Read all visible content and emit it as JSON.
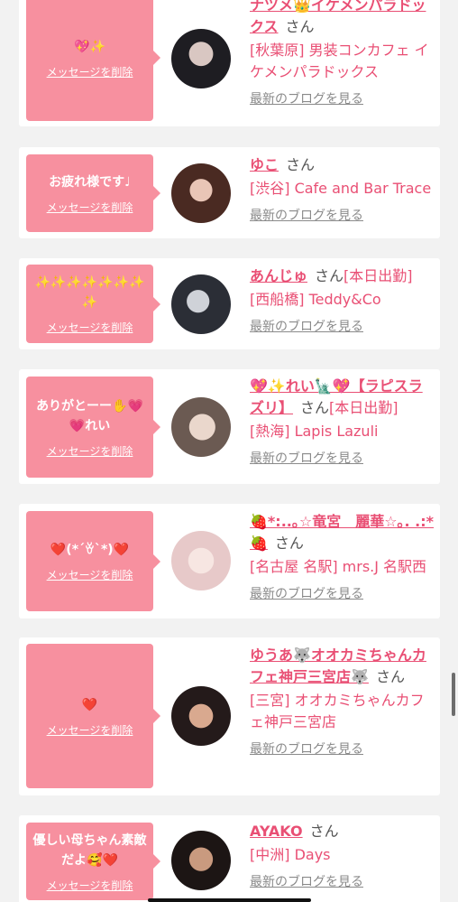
{
  "common": {
    "delete_label": "メッセージを削除",
    "san_label": "さん",
    "blog_label": "最新のブログを見る"
  },
  "cards": [
    {
      "message": "💖✨",
      "name": "ナツメ👑イケメンパラドックス",
      "today": "",
      "shop": "[秋葉原] 男装コンカフェ イケメンパラドックス",
      "avatar_colors": [
        "#1e1d22",
        "#d9c7c2"
      ]
    },
    {
      "message": "お疲れ様です♩",
      "name": "ゆこ",
      "today": "",
      "shop": "[渋谷] Cafe and Bar Trace",
      "avatar_colors": [
        "#4a2a22",
        "#e9c5b6"
      ]
    },
    {
      "message": "✨✨✨✨✨✨✨✨",
      "name": "あんじゅ",
      "today": "[本日出勤]",
      "shop": "[西船橋] Teddy&Co",
      "avatar_colors": [
        "#2b2e36",
        "#cfd2d8"
      ]
    },
    {
      "message": "ありがとーー✋💗💗れい",
      "name": "💖✨れい🗽💖【ラピスラズリ】",
      "today": "[本日出勤]",
      "shop": "[熱海] Lapis Lazuli",
      "avatar_colors": [
        "#6b5a52",
        "#ead7cc"
      ]
    },
    {
      "message": "❤️(*´ꈊ`*)❤️",
      "name": "🍓*:..｡☆竜宮　麗華☆｡. .:*🍓",
      "today": "",
      "shop": "[名古屋 名駅] mrs.J 名駅西",
      "avatar_colors": [
        "#e7c9c9",
        "#f7e6e2"
      ]
    },
    {
      "message": "❤️",
      "name": "ゆうあ🐺オオカミちゃんカフェ神戸三宮店🐺",
      "today": "",
      "shop": "[三宮] オオカミちゃんカフェ神戸三宮店",
      "avatar_colors": [
        "#241a1a",
        "#d9a98f"
      ]
    },
    {
      "message": "優しい母ちゃん素敵だよ🥰❤️",
      "name": "AYAKO",
      "today": "",
      "shop": "[中洲] Days",
      "avatar_colors": [
        "#1c1514",
        "#c99a7f"
      ]
    }
  ]
}
